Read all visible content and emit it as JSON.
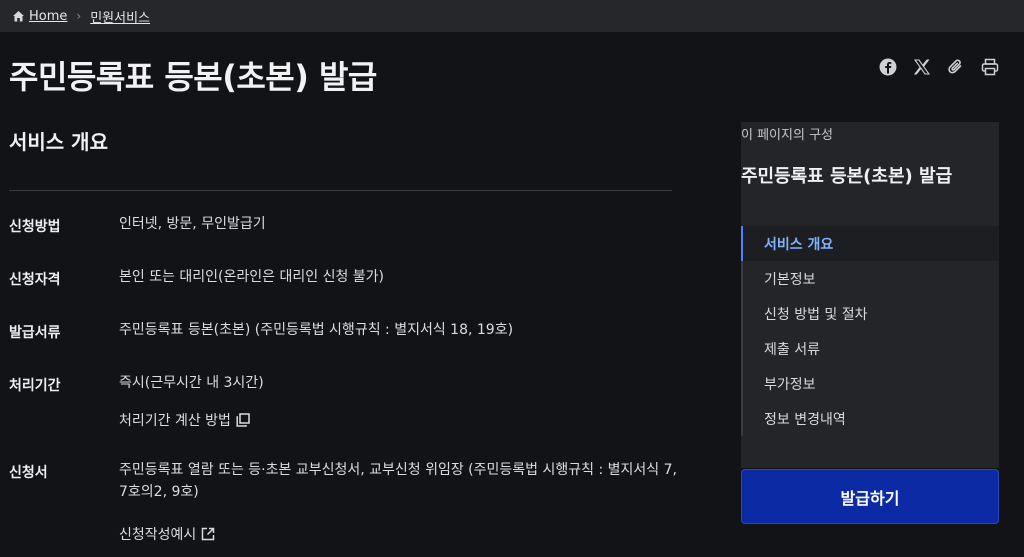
{
  "breadcrumb": {
    "home": "Home",
    "current": "민원서비스"
  },
  "page_title": "주민등록표 등본(초본) 발급",
  "share_icons": [
    "facebook-icon",
    "x-icon",
    "link-icon",
    "print-icon"
  ],
  "overview": {
    "title": "서비스 개요",
    "rows": [
      {
        "label": "신청방법",
        "value": "인터넷, 방문, 무인발급기"
      },
      {
        "label": "신청자격",
        "value": "본인 또는 대리인(온라인은 대리인 신청 불가)"
      },
      {
        "label": "발급서류",
        "value": "주민등록표 등본(초본) (주민등록법 시행규칙 : 별지서식 18, 19호)"
      },
      {
        "label": "처리기간",
        "value": "즉시(근무시간 내 3시간)",
        "link": "처리기간 계산 방법"
      },
      {
        "label": "신청서",
        "value": "주민등록표 열람 또는 등·초본 교부신청서, 교부신청 위임장 (주민등록법 시행규칙 : 별지서식 7, 7호의2, 9호)",
        "link": "신청작성예시"
      }
    ]
  },
  "toc": {
    "caption": "이 페이지의 구성",
    "title": "주민등록표 등본(초본) 발급",
    "items": [
      "서비스 개요",
      "기본정보",
      "신청 방법 및 절차",
      "제출 서류",
      "부가정보",
      "정보 변경내역"
    ]
  },
  "issue_button": "발급하기",
  "colors": {
    "background": "#121317",
    "accent": "#7fb2ff",
    "button": "#0b2aa3"
  }
}
